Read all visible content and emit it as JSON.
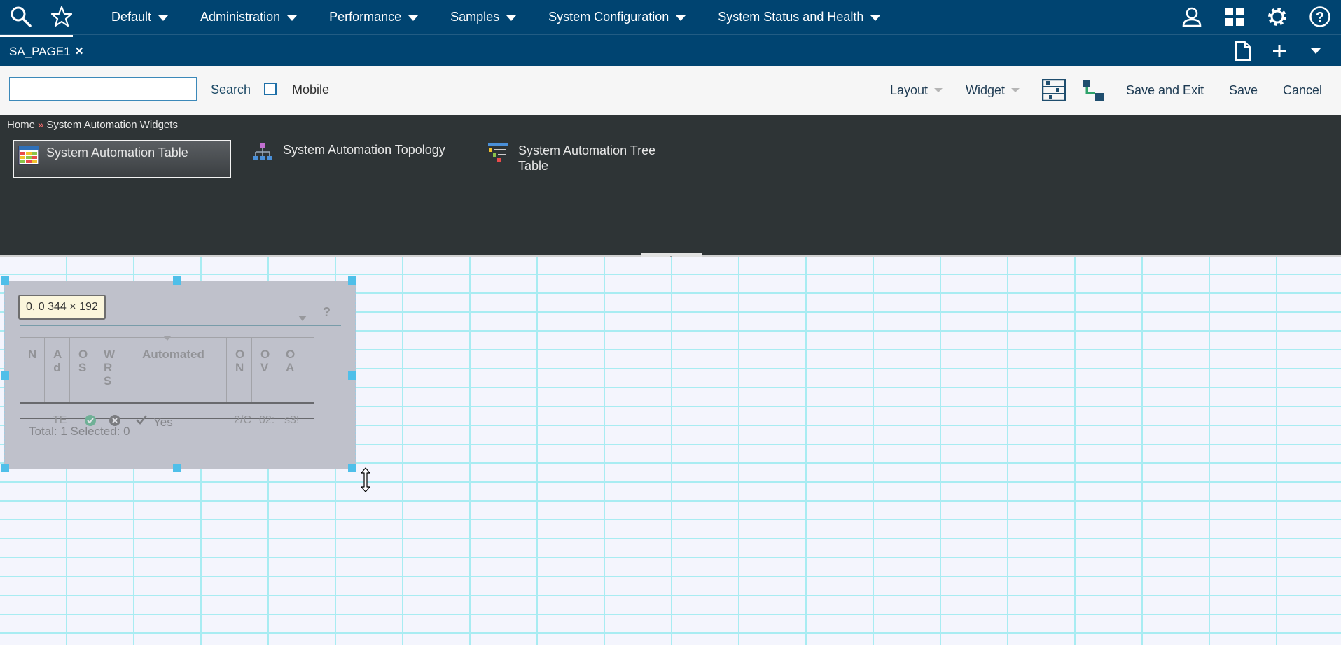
{
  "nav": {
    "menu": [
      "Default",
      "Administration",
      "Performance",
      "Samples",
      "System Configuration",
      "System Status and Health"
    ],
    "icons": [
      "search-icon",
      "star-icon",
      "user-icon",
      "grid-icon",
      "gear-icon",
      "help-icon"
    ]
  },
  "tabs": {
    "active": "SA_PAGE1",
    "close_icon": "×"
  },
  "toolbar": {
    "search_value": "",
    "search_label": "Search",
    "mobile_label": "Mobile",
    "mobile_checked": false,
    "layout_label": "Layout",
    "widget_label": "Widget",
    "save_exit_label": "Save and Exit",
    "save_label": "Save",
    "cancel_label": "Cancel"
  },
  "palette": {
    "breadcrumb_home": "Home",
    "breadcrumb_sep": "»",
    "breadcrumb_current": "System Automation Widgets",
    "widgets": [
      {
        "label": "System Automation Table",
        "selected": true
      },
      {
        "label": "System Automation Topology",
        "selected": false
      },
      {
        "label": "System Automation Tree Table",
        "selected": false
      }
    ]
  },
  "placed_widget": {
    "coord_tooltip": "0, 0  344 × 192",
    "columns": [
      "N",
      "Ad",
      "OS",
      "WRS",
      "Automated",
      "ON",
      "OV",
      "OA"
    ],
    "row_cells": [
      "TE",
      "Yes",
      "2/C",
      "02:",
      "s3!"
    ],
    "help_glyph": "?",
    "footer": "Total: 1 Selected: 0"
  },
  "colors": {
    "nav_bg": "#004471",
    "palette_bg": "#2e3436",
    "grid_line": "#a8ecf2",
    "handle": "#4fbfe9"
  }
}
